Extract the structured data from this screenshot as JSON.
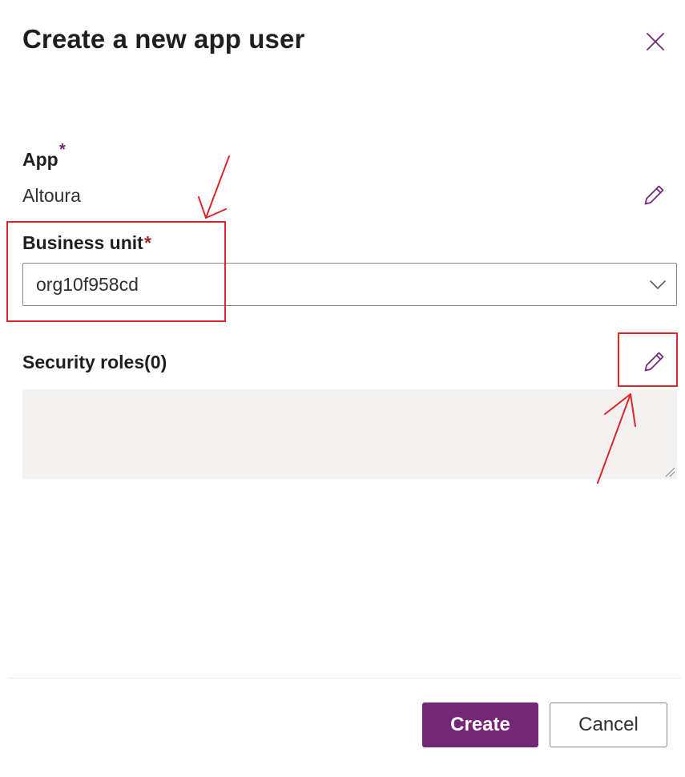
{
  "dialog": {
    "title": "Create a new app user",
    "close_icon": "close-icon"
  },
  "app_field": {
    "label": "App",
    "required_mark": "*",
    "value": "Altoura",
    "edit_icon": "pencil-icon"
  },
  "business_unit": {
    "label": "Business unit",
    "required_mark": "*",
    "selected_value": "org10f958cd",
    "chevron_icon": "chevron-down-icon"
  },
  "security_roles": {
    "label": "Security roles(0)",
    "edit_icon": "pencil-icon"
  },
  "footer": {
    "create_label": "Create",
    "cancel_label": "Cancel"
  },
  "colors": {
    "accent": "#742774",
    "required_app": "#742774",
    "required_bu": "#a4262c",
    "annotation": "#e0242b",
    "roles_box_bg": "#f3f2f1"
  }
}
